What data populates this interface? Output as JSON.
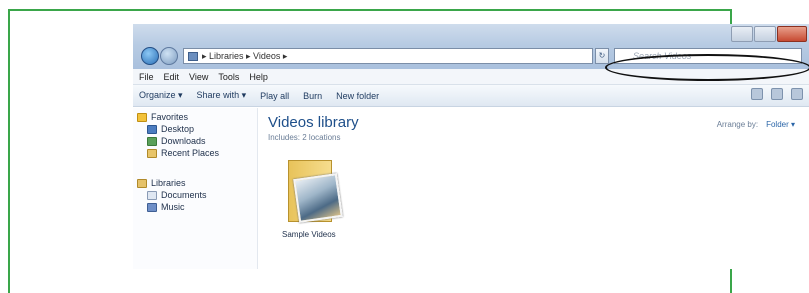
{
  "window": {
    "address_path": "▸ Libraries ▸ Videos ▸",
    "search_placeholder": "Search Videos"
  },
  "menu": [
    "File",
    "Edit",
    "View",
    "Tools",
    "Help"
  ],
  "toolbar": [
    "Organize ▾",
    "Share with ▾",
    "Play all",
    "Burn",
    "New folder"
  ],
  "nav": {
    "favorites": "Favorites",
    "desktop": "Desktop",
    "downloads": "Downloads",
    "recent": "Recent Places",
    "libraries": "Libraries",
    "documents": "Documents",
    "music": "Music"
  },
  "content": {
    "title": "Videos library",
    "subtitle": "Includes: 2 locations",
    "arrange_label": "Arrange by:",
    "arrange_value": "Folder ▾",
    "folder_label": "Sample Videos"
  },
  "colors": {
    "frame_green": "#3aa64a",
    "library_title": "#1e4f8a"
  }
}
